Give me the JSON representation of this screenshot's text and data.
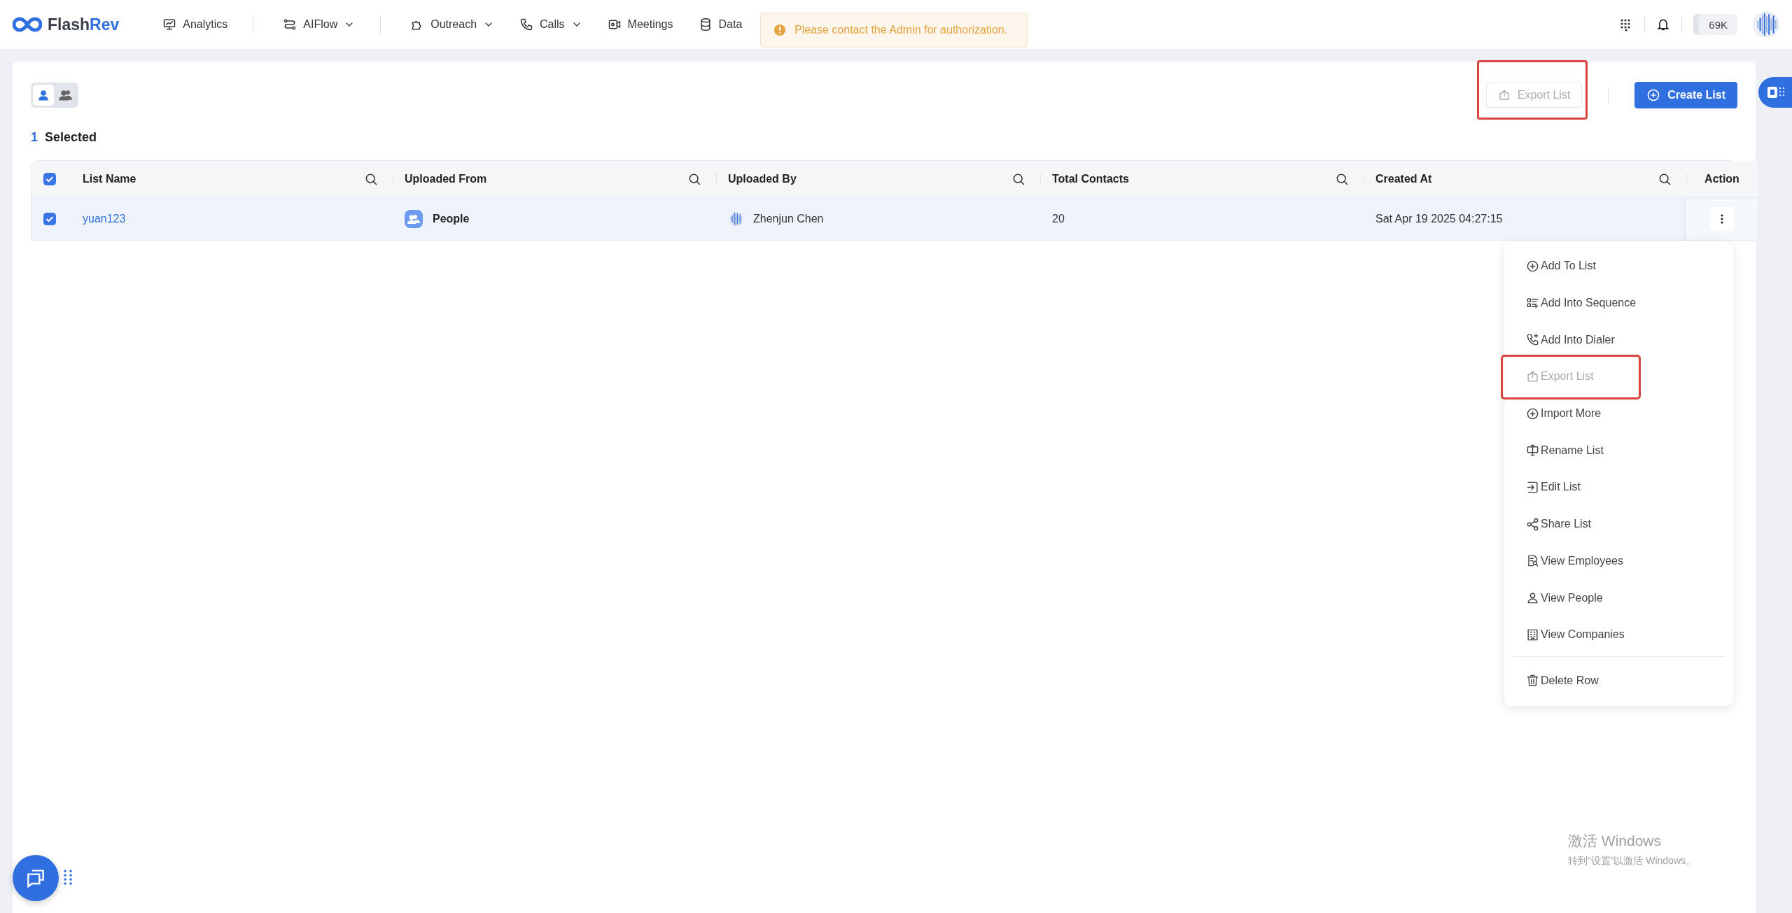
{
  "brand": "FlashRev",
  "nav": [
    {
      "label": "Analytics",
      "dropdown": false,
      "divider_after": true
    },
    {
      "label": "AIFlow",
      "dropdown": true,
      "divider_after": true
    },
    {
      "label": "Outreach",
      "dropdown": true,
      "divider_after": false
    },
    {
      "label": "Calls",
      "dropdown": true,
      "divider_after": false
    },
    {
      "label": "Meetings",
      "dropdown": false,
      "divider_after": false
    },
    {
      "label": "Data",
      "dropdown": false,
      "divider_after": false
    }
  ],
  "toast": {
    "message": "Please contact the Admin for authorization."
  },
  "credits": "69K",
  "view_toggle": [
    {
      "kind": "person",
      "selected": true
    },
    {
      "kind": "people",
      "selected": false
    }
  ],
  "selection": {
    "count": "1",
    "label": "Selected"
  },
  "toolbar": [
    {
      "label": "Export List",
      "kind": "outline",
      "disabled": true,
      "highlighted": true
    },
    {
      "label": "Create List",
      "kind": "primary",
      "disabled": false,
      "highlighted": false
    }
  ],
  "table": {
    "all_checked": true,
    "columns": [
      {
        "label": "List Name",
        "searchable": true
      },
      {
        "label": "Uploaded From",
        "searchable": true
      },
      {
        "label": "Uploaded By",
        "searchable": true
      },
      {
        "label": "Total Contacts",
        "searchable": true
      },
      {
        "label": "Created At",
        "searchable": true
      },
      {
        "label": "Action",
        "searchable": false
      }
    ],
    "rows": [
      {
        "checked": true,
        "list_name": "yuan123",
        "uploaded_from": "People",
        "uploaded_by": "Zhenjun Chen",
        "total_contacts": "20",
        "created_at": "Sat Apr 19 2025 04:27:15"
      }
    ]
  },
  "action_menu": [
    {
      "label": "Add To List",
      "disabled": false,
      "highlighted": false,
      "separated": false
    },
    {
      "label": "Add Into Sequence",
      "disabled": false,
      "highlighted": false,
      "separated": false
    },
    {
      "label": "Add Into Dialer",
      "disabled": false,
      "highlighted": false,
      "separated": false
    },
    {
      "label": "Export List",
      "disabled": true,
      "highlighted": true,
      "separated": false
    },
    {
      "label": "Import More",
      "disabled": false,
      "highlighted": false,
      "separated": false
    },
    {
      "label": "Rename List",
      "disabled": false,
      "highlighted": false,
      "separated": false
    },
    {
      "label": "Edit List",
      "disabled": false,
      "highlighted": false,
      "separated": false
    },
    {
      "label": "Share List",
      "disabled": false,
      "highlighted": false,
      "separated": false
    },
    {
      "label": "View Employees",
      "disabled": false,
      "highlighted": false,
      "separated": false
    },
    {
      "label": "View People",
      "disabled": false,
      "highlighted": false,
      "separated": false
    },
    {
      "label": "View Companies",
      "disabled": false,
      "highlighted": false,
      "separated": false
    },
    {
      "label": "Delete Row",
      "disabled": false,
      "highlighted": false,
      "separated": true
    }
  ],
  "os_notice": {
    "title": "激活 Windows",
    "subtitle": "转到“设置”以激活 Windows。"
  }
}
